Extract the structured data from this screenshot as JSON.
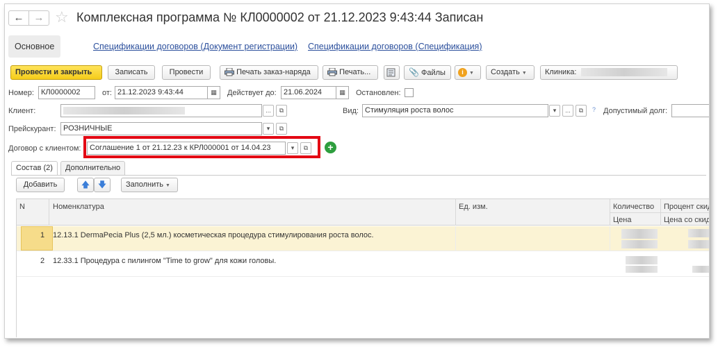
{
  "window": {
    "title": "Комплексная программа № КЛ0000002 от 21.12.2023 9:43:44 Записан"
  },
  "nav": {
    "back": "←",
    "forward": "→"
  },
  "tabs": {
    "main": "Основное",
    "link1": "Спецификации договоров (Документ регистрации)",
    "link2": "Спецификации договоров (Спецификация)"
  },
  "toolbar": {
    "post_close": "Провести и закрыть",
    "save": "Записать",
    "post": "Провести",
    "print_order": "Печать заказ-наряда",
    "print": "Печать...",
    "files": "Файлы",
    "create": "Создать",
    "clinic_label": "Клиника:"
  },
  "form": {
    "number_label": "Номер:",
    "number_value": "КЛ0000002",
    "date_label": "от:",
    "date_value": "21.12.2023  9:43:44",
    "valid_label": "Действует до:",
    "valid_value": "21.06.2024",
    "stopped_label": "Остановлен:",
    "client_label": "Клиент:",
    "vid_label": "Вид:",
    "vid_value": "Стимуляция роста волос",
    "debt_label": "Допустимый долг:",
    "help_mark": "?",
    "price_label": "Прейскурант:",
    "price_value": "РОЗНИЧНЫЕ",
    "contract_label": "Договор с клиентом:",
    "contract_value": "Соглашение 1 от 21.12.23 к КРЛ000001 от 14.04.23"
  },
  "inner_tabs": {
    "composition": "Состав (2)",
    "additional": "Дополнительно"
  },
  "table_toolbar": {
    "add": "Добавить",
    "fill": "Заполнить"
  },
  "table": {
    "headers": {
      "n": "N",
      "nomenclature": "Номенклатура",
      "unit": "Ед. изм.",
      "quantity": "Количество",
      "discount_percent": "Процент скид",
      "price": "Цена",
      "price_discount": "Цена со скид"
    },
    "rows": [
      {
        "n": "1",
        "name": "12.13.1 DermaPecia Plus (2,5 мл.) косметическая процедура стимулирования роста волос."
      },
      {
        "n": "2",
        "name": "12.33.1 Процедура с пилингом \"Time to grow\" для кожи головы."
      }
    ]
  },
  "colors": {
    "primary_button": "#f5cc1a",
    "link": "#2b4f9c",
    "highlight": "#e30613",
    "selected_row": "#fbf3d4",
    "add_icon": "#2e9e3e"
  }
}
